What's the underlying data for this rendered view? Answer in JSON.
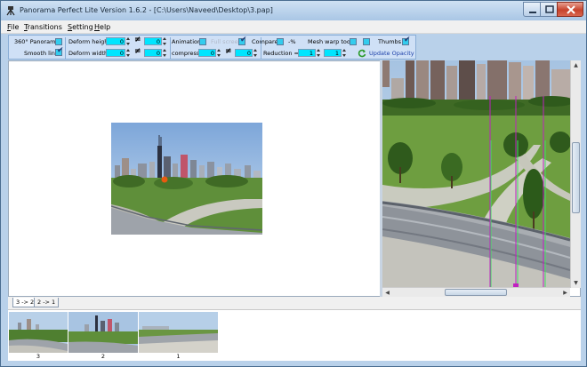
{
  "window": {
    "title": "Panorama Perfect Lite Version 1.6.2 - [C:\\Users\\Naveed\\Desktop\\3.pap]",
    "icon": "app-tripod-icon"
  },
  "menu": [
    {
      "key": "F",
      "rest": "ile"
    },
    {
      "key": "T",
      "rest": "ransitions"
    },
    {
      "key": "S",
      "rest": "etting"
    },
    {
      "key": "H",
      "rest": "elp"
    }
  ],
  "toolbar": {
    "panorama_360": "360° Panorama",
    "smooth_line": "Smooth line",
    "deform_height": "Deform height:",
    "deform_width": "Deform width:",
    "deform_height_value_1": "0",
    "deform_height_value_2": "0",
    "deform_width_value_1": "0",
    "deform_width_value_2": "0",
    "neq": "≠",
    "animation": "Animation",
    "full_screen": "Full screen",
    "compare": "Compare",
    "percent": "-%",
    "mesh_warp_tool": "Mesh warp tool",
    "thumbs": "Thumbs",
    "compress": "compress:",
    "compress_value_1": "0",
    "compress_value_2": "0",
    "reduction": "Reduction =",
    "reduction_value_1": "1",
    "reduction_value_2": "1",
    "update_opacity": "Update Opacity"
  },
  "checkboxes": {
    "panorama_360": false,
    "smooth_line": true,
    "animation": false,
    "full_screen": true,
    "compare": false,
    "mesh_warp_tool": false,
    "mesh_warp_tool_2": false,
    "thumbs": true
  },
  "tabs": [
    "3 -> 2",
    "2 -> 1"
  ],
  "thumbnails": [
    {
      "label": "3"
    },
    {
      "label": "2"
    },
    {
      "label": "1"
    }
  ],
  "colors": {
    "field_fill": "#00e5ff",
    "toolbar_bg": "#cfe0f6",
    "guide_magenta": "#c020c0",
    "guide_green": "#40e060"
  }
}
